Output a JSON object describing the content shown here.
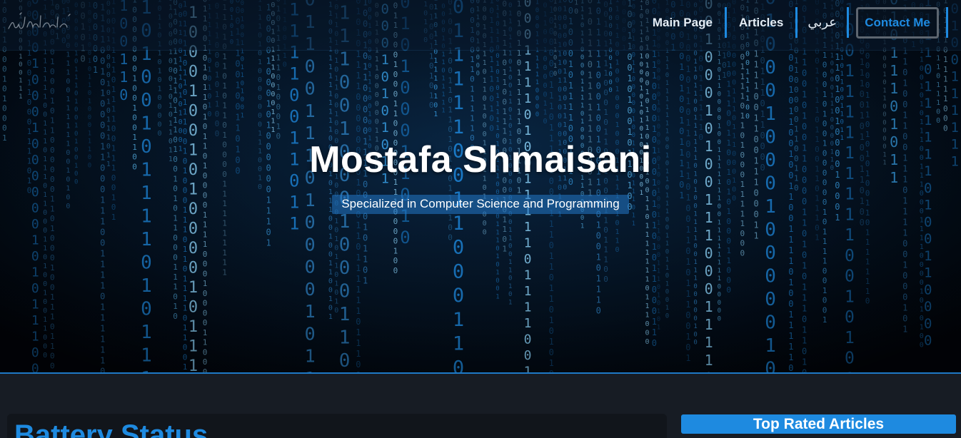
{
  "logo": {
    "icon": "basmala-calligraphy-logo"
  },
  "nav": {
    "items": [
      {
        "label": "Main Page"
      },
      {
        "label": "Articles"
      },
      {
        "label": "عربي"
      }
    ],
    "contact_label": "Contact Me"
  },
  "hero": {
    "title": "Mostafa Shmaisani",
    "subtitle": "Specialized in Computer Science and Programming",
    "background": "binary-matrix-rain"
  },
  "battery": {
    "title": "Battery Status"
  },
  "sidebar": {
    "top_rated_title": "Top Rated Articles"
  },
  "colors": {
    "accent": "#1e8ae0",
    "page_background": "#171c24",
    "card_background": "#11151b",
    "nav_text": "#e6eef6"
  }
}
